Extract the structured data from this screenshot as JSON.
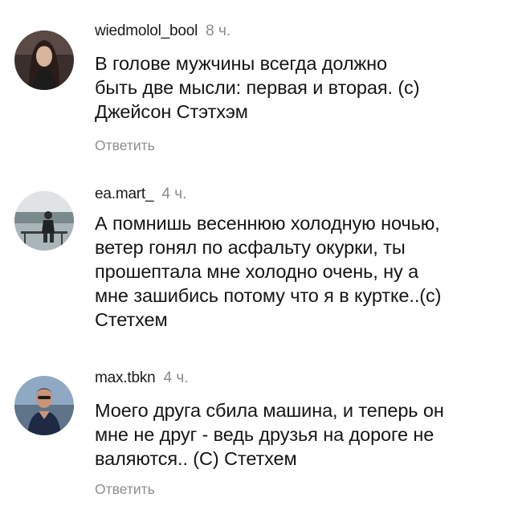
{
  "comments": [
    {
      "username": "wiedmolol_bool",
      "time": "8 ч.",
      "lines": [
        "В голове мужчины всегда должно",
        "быть две мысли: первая и вторая. (с)",
        "Джейсон Стэтхэм"
      ],
      "reply_label": "Ответить"
    },
    {
      "username": "ea.mart_",
      "time": "4 ч.",
      "lines": [
        "А помнишь весеннюю холодную ночью,",
        "ветер гонял по асфальту окурки, ты",
        "прошептала мне холодно очень, ну а",
        "мне зашибись потому что я в куртке..(с)",
        "Стетхем"
      ]
    },
    {
      "username": "max.tbkn",
      "time": "4 ч.",
      "lines": [
        "Моего друга сбила машина, и теперь он",
        "мне не друг - ведь друзья на дороге не",
        "валяются.. (С) Стетхем"
      ],
      "reply_label": "Ответить"
    }
  ],
  "colors": {
    "username": "#1a1a1a",
    "text": "#151515",
    "muted": "#8a8a8a",
    "background": "#ffffff"
  },
  "icons": [
    "avatar-photo-long-hair",
    "avatar-photo-lake",
    "avatar-photo-man"
  ]
}
